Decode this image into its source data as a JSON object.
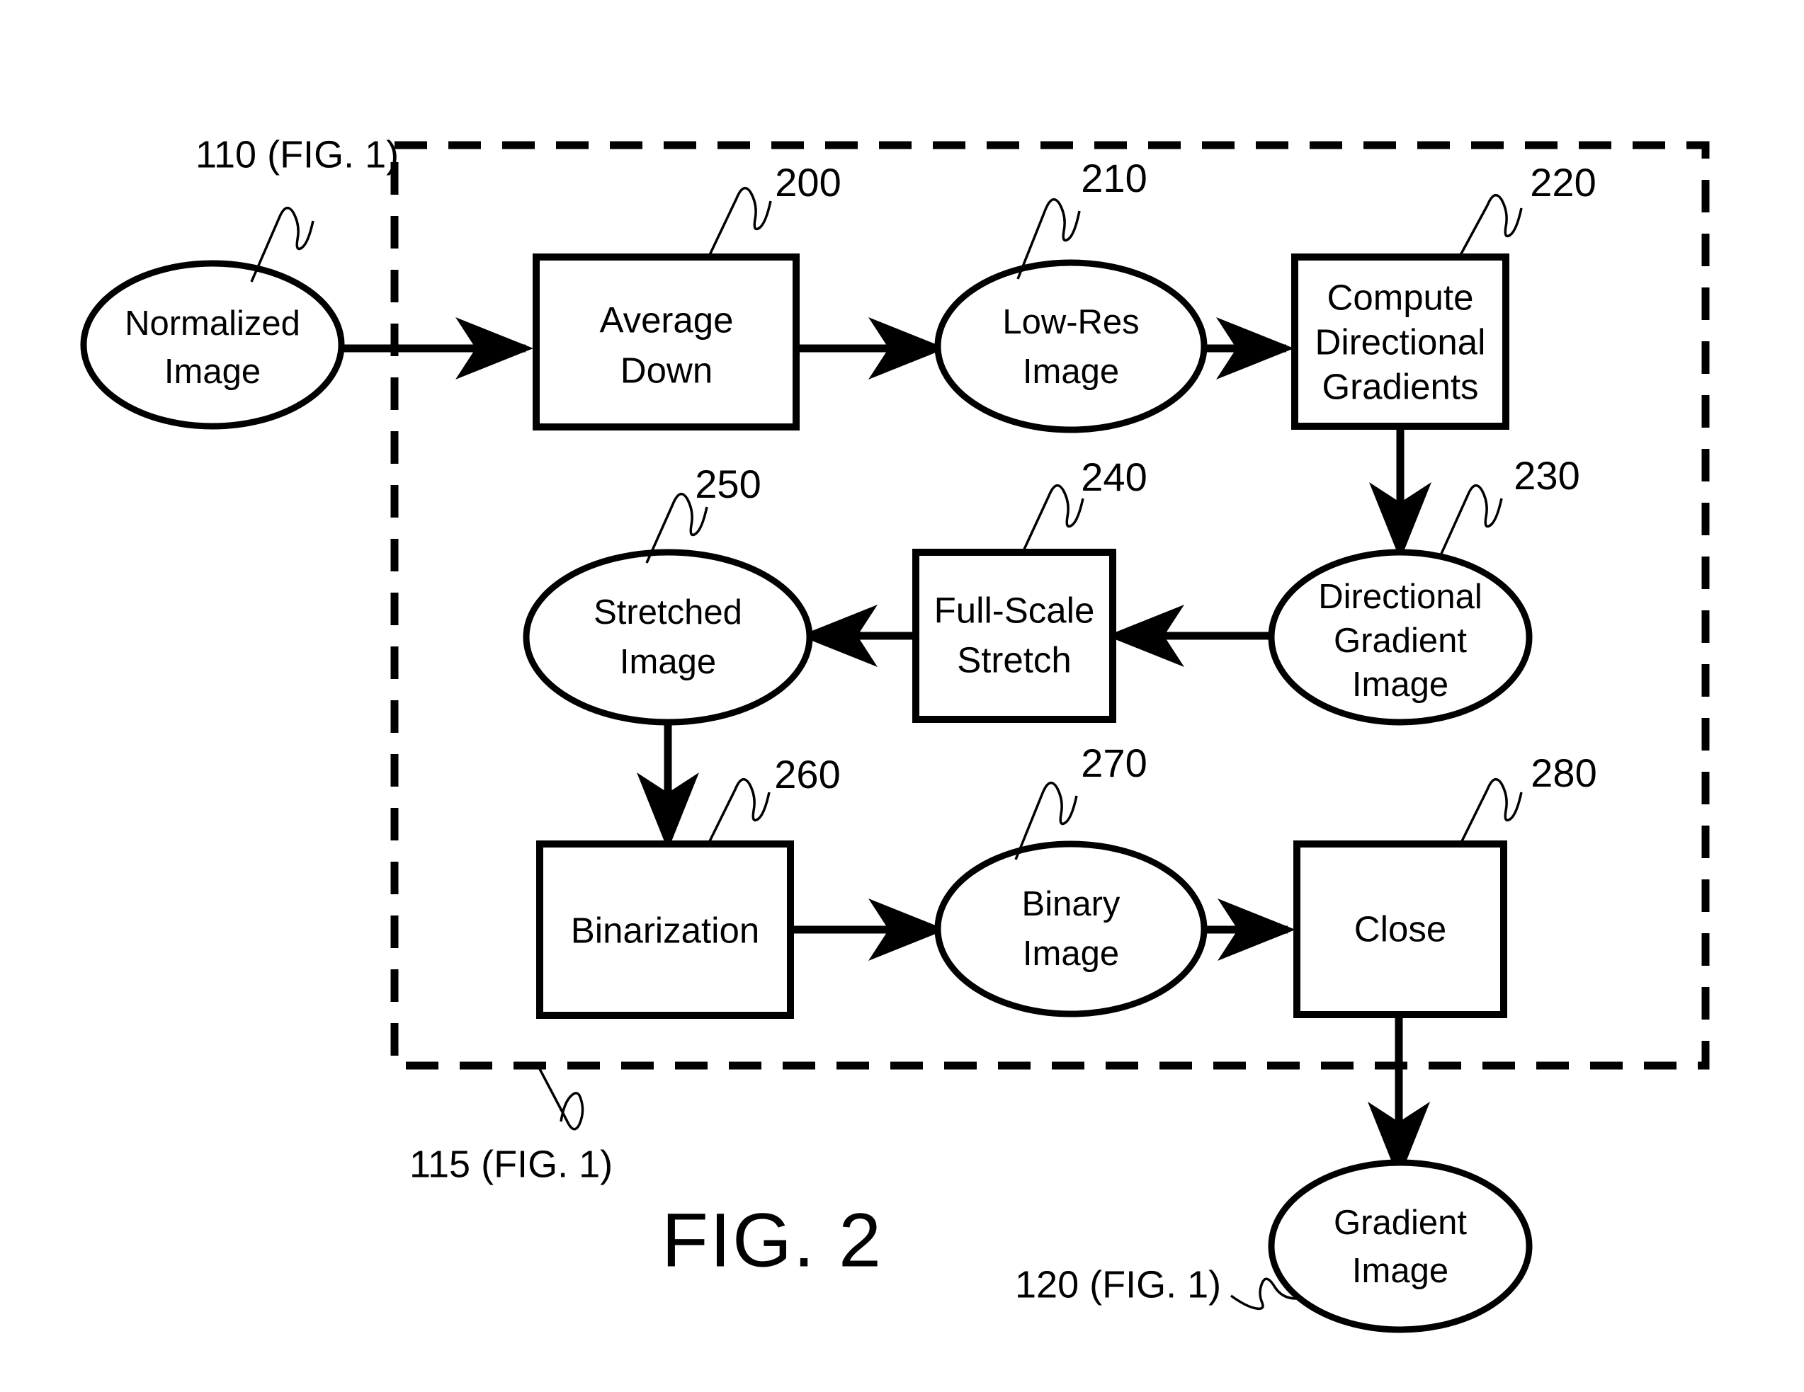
{
  "figure": {
    "title": "FIG. 2",
    "group_box": {
      "name": "gradient-extraction-module",
      "ref_label": "115 (FIG. 1)"
    }
  },
  "external_refs": [
    {
      "id": "ref-110",
      "label": "110 (FIG. 1)"
    },
    {
      "id": "ref-115",
      "label": "115 (FIG. 1)"
    },
    {
      "id": "ref-120",
      "label": "120 (FIG. 1)"
    }
  ],
  "nodes": [
    {
      "id": "normalized-image",
      "kind": "terminal",
      "lines": [
        "Normalized",
        "Image"
      ],
      "ref": ""
    },
    {
      "id": "average-down",
      "kind": "process",
      "lines": [
        "Average",
        "Down"
      ],
      "ref": "200"
    },
    {
      "id": "low-res-image",
      "kind": "terminal",
      "lines": [
        "Low-Res",
        "Image"
      ],
      "ref": "210"
    },
    {
      "id": "compute-directional-gradients",
      "kind": "process",
      "lines": [
        "Compute",
        "Directional",
        "Gradients"
      ],
      "ref": "220"
    },
    {
      "id": "directional-gradient-image",
      "kind": "terminal",
      "lines": [
        "Directional",
        "Gradient",
        "Image"
      ],
      "ref": "230"
    },
    {
      "id": "full-scale-stretch",
      "kind": "process",
      "lines": [
        "Full-Scale",
        "Stretch"
      ],
      "ref": "240"
    },
    {
      "id": "stretched-image",
      "kind": "terminal",
      "lines": [
        "Stretched",
        "Image"
      ],
      "ref": "250"
    },
    {
      "id": "binarization",
      "kind": "process",
      "lines": [
        "Binarization"
      ],
      "ref": "260"
    },
    {
      "id": "binary-image",
      "kind": "terminal",
      "lines": [
        "Binary",
        "Image"
      ],
      "ref": "270"
    },
    {
      "id": "close",
      "kind": "process",
      "lines": [
        "Close"
      ],
      "ref": "280"
    },
    {
      "id": "gradient-image",
      "kind": "terminal",
      "lines": [
        "Gradient",
        "Image"
      ],
      "ref": ""
    }
  ],
  "edges": [
    {
      "from": "normalized-image",
      "to": "average-down"
    },
    {
      "from": "average-down",
      "to": "low-res-image"
    },
    {
      "from": "low-res-image",
      "to": "compute-directional-gradients"
    },
    {
      "from": "compute-directional-gradients",
      "to": "directional-gradient-image"
    },
    {
      "from": "directional-gradient-image",
      "to": "full-scale-stretch"
    },
    {
      "from": "full-scale-stretch",
      "to": "stretched-image"
    },
    {
      "from": "stretched-image",
      "to": "binarization"
    },
    {
      "from": "binarization",
      "to": "binary-image"
    },
    {
      "from": "binary-image",
      "to": "close"
    },
    {
      "from": "close",
      "to": "gradient-image"
    }
  ],
  "text": {
    "normalized_image_l1": "Normalized",
    "normalized_image_l2": "Image",
    "average_down_l1": "Average",
    "average_down_l2": "Down",
    "low_res_image_l1": "Low-Res",
    "low_res_image_l2": "Image",
    "compute_grad_l1": "Compute",
    "compute_grad_l2": "Directional",
    "compute_grad_l3": "Gradients",
    "dir_grad_image_l1": "Directional",
    "dir_grad_image_l2": "Gradient",
    "dir_grad_image_l3": "Image",
    "full_scale_stretch_l1": "Full-Scale",
    "full_scale_stretch_l2": "Stretch",
    "stretched_image_l1": "Stretched",
    "stretched_image_l2": "Image",
    "binarization_l1": "Binarization",
    "binary_image_l1": "Binary",
    "binary_image_l2": "Image",
    "close_l1": "Close",
    "gradient_image_l1": "Gradient",
    "gradient_image_l2": "Image",
    "ref_200": "200",
    "ref_210": "210",
    "ref_220": "220",
    "ref_230": "230",
    "ref_240": "240",
    "ref_250": "250",
    "ref_260": "260",
    "ref_270": "270",
    "ref_280": "280",
    "ref_110_fig1": "110 (FIG. 1)",
    "ref_115_fig1": "115 (FIG. 1)",
    "ref_120_fig1": "120 (FIG. 1)",
    "fig_title": "FIG. 2"
  },
  "colors": {
    "ink": "#000000",
    "paper": "#ffffff"
  }
}
